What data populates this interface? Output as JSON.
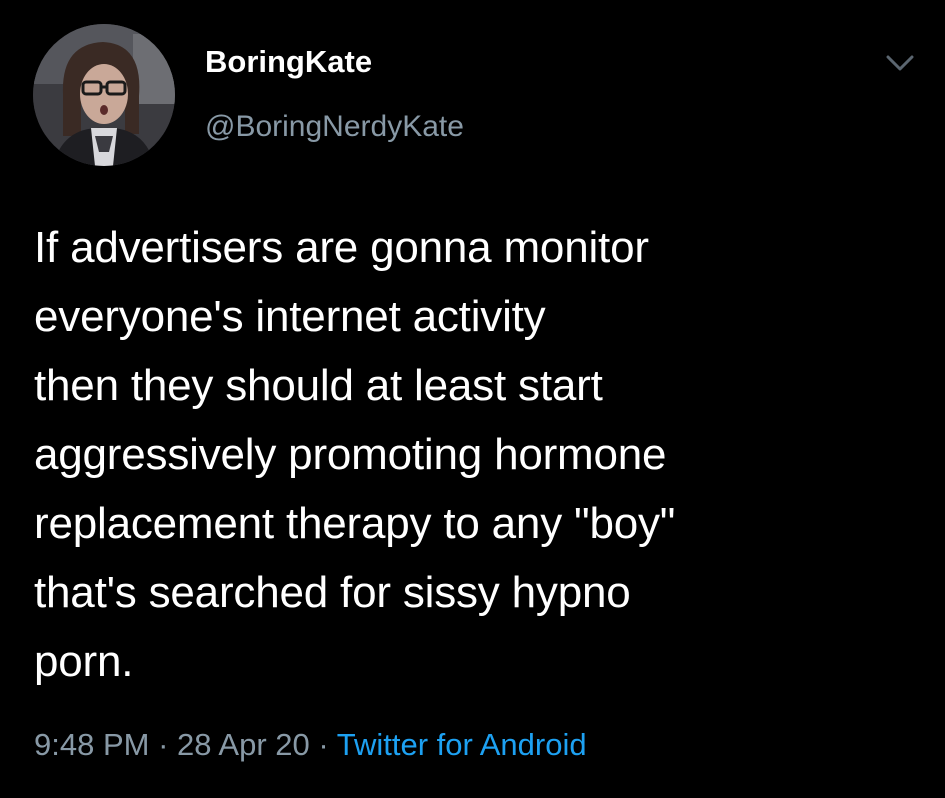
{
  "tweet": {
    "display_name": "BoringKate",
    "handle": "@BoringNerdyKate",
    "text": "If advertisers are gonna monitor\neveryone's internet activity\nthen they should at least start\naggressively promoting hormone\nreplacement therapy to any \"boy\"\nthat's searched for sissy hypno\nporn.",
    "time": "9:48 PM",
    "date": "28 Apr 20",
    "separator": " · ",
    "source": "Twitter for Android",
    "menu_icon": "chevron-down-icon",
    "avatar_icon": "avatar"
  },
  "colors": {
    "background": "#000000",
    "text": "#ffffff",
    "secondary": "#8899a6",
    "link": "#1da1f2"
  }
}
